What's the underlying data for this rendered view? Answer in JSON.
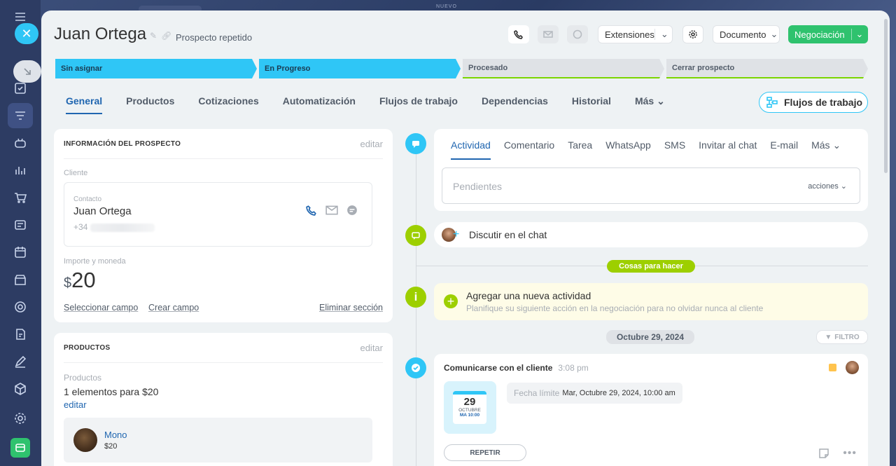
{
  "top_label": "NUEVO",
  "header": {
    "title": "Juan Ortega",
    "subtitle": "Prospecto repetido",
    "extensions_label": "Extensiones",
    "document_label": "Documento",
    "deal_label": "Negociación"
  },
  "stages": [
    {
      "label": "Sin asignar",
      "state": "current"
    },
    {
      "label": "En Progreso",
      "state": "current"
    },
    {
      "label": "Procesado",
      "state": "pending"
    },
    {
      "label": "Cerrar prospecto",
      "state": "pending"
    }
  ],
  "tabs": [
    "General",
    "Productos",
    "Cotizaciones",
    "Automatización",
    "Flujos de trabajo",
    "Dependencias",
    "Historial",
    "Más"
  ],
  "flows_button": "Flujos de trabajo",
  "info_card": {
    "title": "INFORMACIÓN DEL PROSPECTO",
    "edit": "editar",
    "client_label": "Cliente",
    "contact_label": "Contacto",
    "contact_name": "Juan Ortega",
    "contact_phone": "+34",
    "amount_label": "Importe y moneda",
    "currency": "$",
    "amount": "20",
    "select_field": "Seleccionar campo",
    "create_field": "Crear campo",
    "delete_section": "Eliminar sección"
  },
  "products_card": {
    "title": "PRODUCTOS",
    "edit": "editar",
    "products_label": "Productos",
    "summary": "1 elementos para $20",
    "edit_link": "editar",
    "item_name": "Mono",
    "item_price": "$20"
  },
  "activity": {
    "tabs": [
      "Actividad",
      "Comentario",
      "Tarea",
      "WhatsApp",
      "SMS",
      "Invitar al chat",
      "E-mail",
      "Más"
    ],
    "pending_placeholder": "Pendientes",
    "actions_label": "acciones",
    "chat_label": "Discutir en el chat",
    "todo_pill": "Cosas para hacer",
    "new_activity_title": "Agregar una nueva actividad",
    "new_activity_desc": "Planifique su siguiente acción en la negociación para no olvidar nunca al cliente",
    "date_pill": "Octubre 29, 2024",
    "filter_label": "FILTRO",
    "task_title": "Comunicarse con el cliente",
    "task_time": "3:08 pm",
    "calendar_day": "29",
    "calendar_month": "OCTUBRE",
    "calendar_sub": "MA 10:00",
    "deadline_label": "Fecha límite",
    "deadline_value": "Mar, Octubre 29, 2024, 10:00 am",
    "repeat_button": "REPETIR"
  },
  "colors": {
    "accent_blue": "#2fc6f6",
    "green": "#2fc26e",
    "lime": "#9dcf00",
    "link": "#2066b0"
  }
}
